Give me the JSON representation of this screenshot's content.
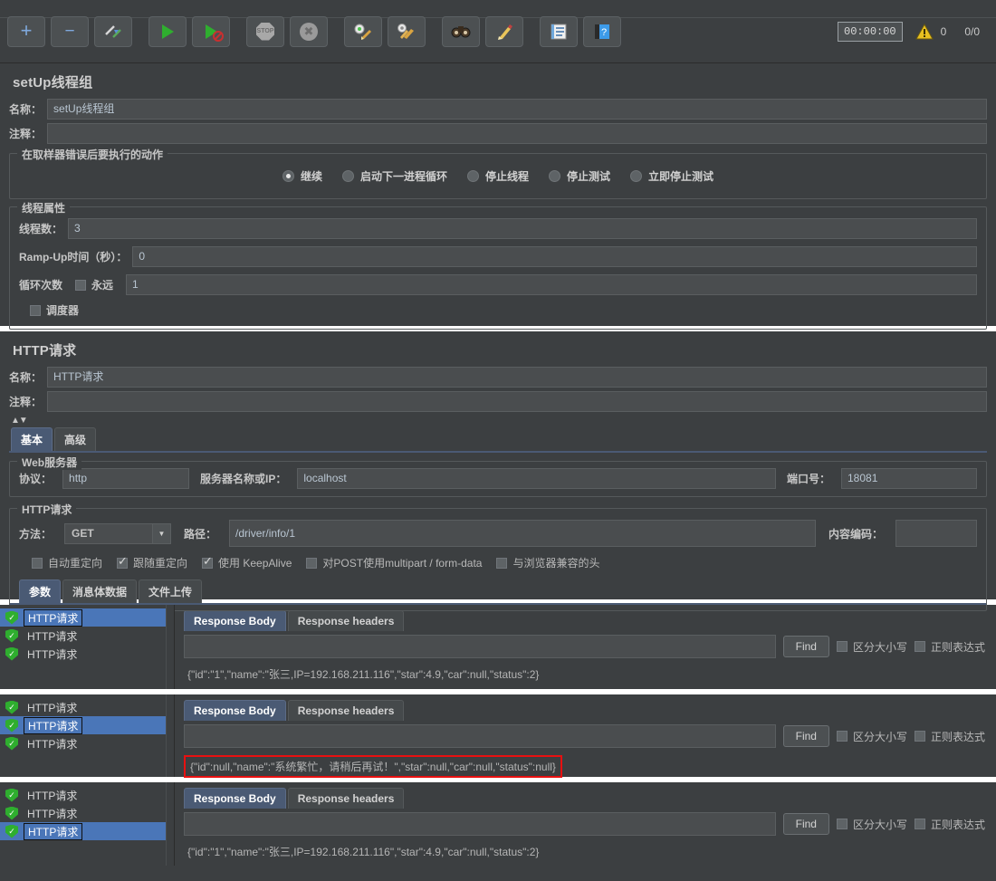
{
  "toolbar": {
    "buttons": [
      {
        "name": "add-button",
        "icon": "plus-icon",
        "title": "+"
      },
      {
        "name": "remove-button",
        "icon": "minus-icon",
        "title": "−"
      },
      {
        "name": "toggle-button",
        "icon": "pencil-toggle-icon",
        "title": ""
      },
      {
        "name": "start-button",
        "icon": "play-icon",
        "title": ""
      },
      {
        "name": "start-no-pauses-button",
        "icon": "play-no-pause-icon",
        "title": ""
      },
      {
        "name": "stop-button",
        "icon": "stop-octagon-icon",
        "title": "STOP"
      },
      {
        "name": "shutdown-button",
        "icon": "shutdown-x-icon",
        "title": ""
      },
      {
        "name": "clear-button",
        "icon": "gear-broom-icon",
        "title": ""
      },
      {
        "name": "clear-all-button",
        "icon": "gears-broom-icon",
        "title": ""
      },
      {
        "name": "search-button",
        "icon": "binoculars-icon",
        "title": ""
      },
      {
        "name": "reset-search-button",
        "icon": "broom-icon",
        "title": ""
      },
      {
        "name": "function-helper-button",
        "icon": "list-icon",
        "title": ""
      },
      {
        "name": "help-button",
        "icon": "help-book-icon",
        "title": "?"
      }
    ],
    "timer": "00:00:00",
    "warning_count": "0",
    "thread_ratio": "0/0"
  },
  "thread_group": {
    "title": "setUp线程组",
    "name_label": "名称：",
    "name_value": "setUp线程组",
    "comment_label": "注释：",
    "comment_value": "",
    "on_error_group": "在取样器错误后要执行的动作",
    "on_error_options": [
      {
        "label": "继续",
        "selected": true
      },
      {
        "label": "启动下一进程循环",
        "selected": false
      },
      {
        "label": "停止线程",
        "selected": false
      },
      {
        "label": "停止测试",
        "selected": false
      },
      {
        "label": "立即停止测试",
        "selected": false
      }
    ],
    "props_group": "线程属性",
    "threads_label": "线程数：",
    "threads_value": "3",
    "rampup_label": "Ramp-Up时间（秒）：",
    "rampup_value": "0",
    "loops_label": "循环次数",
    "forever_label": "永远",
    "forever_checked": false,
    "loops_value": "1",
    "scheduler_label": "调度器",
    "scheduler_checked": false
  },
  "http_request": {
    "title": "HTTP请求",
    "name_label": "名称：",
    "name_value": "HTTP请求",
    "comment_label": "注释：",
    "comment_value": "",
    "tabs": [
      {
        "label": "基本",
        "active": true
      },
      {
        "label": "高级",
        "active": false
      }
    ],
    "webserver_group": "Web服务器",
    "protocol_label": "协议：",
    "protocol_value": "http",
    "server_label": "服务器名称或IP：",
    "server_value": "localhost",
    "port_label": "端口号：",
    "port_value": "18081",
    "request_group": "HTTP请求",
    "method_label": "方法：",
    "method_value": "GET",
    "path_label": "路径：",
    "path_value": "/driver/info/1",
    "encoding_label": "内容编码：",
    "encoding_value": "",
    "checkboxes": [
      {
        "label": "自动重定向",
        "checked": false
      },
      {
        "label": "跟随重定向",
        "checked": true
      },
      {
        "label": "使用 KeepAlive",
        "checked": true
      },
      {
        "label": "对POST使用multipart / form-data",
        "checked": false
      },
      {
        "label": "与浏览器兼容的头",
        "checked": false
      }
    ],
    "param_tabs": [
      {
        "label": "参数",
        "active": true
      },
      {
        "label": "消息体数据",
        "active": false
      },
      {
        "label": "文件上传",
        "active": false
      }
    ]
  },
  "results": {
    "find_label": "Find",
    "find_value": "",
    "case_label": "区分大小写",
    "case_checked": false,
    "regex_label": "正则表达式",
    "regex_checked": false,
    "tabs": [
      {
        "label": "Response Body",
        "active": true
      },
      {
        "label": "Response headers",
        "active": false
      }
    ],
    "panels": [
      {
        "name": "result-panel-1",
        "tree": [
          {
            "label": "HTTP请求",
            "selected": true,
            "status": "success"
          },
          {
            "label": "HTTP请求",
            "selected": false,
            "status": "success"
          },
          {
            "label": "HTTP请求",
            "selected": false,
            "status": "success"
          }
        ],
        "body": "{\"id\":\"1\",\"name\":\"张三,IP=192.168.211.116\",\"star\":4.9,\"car\":null,\"status\":2}",
        "highlighted": false
      },
      {
        "name": "result-panel-2",
        "tree": [
          {
            "label": "HTTP请求",
            "selected": false,
            "status": "success"
          },
          {
            "label": "HTTP请求",
            "selected": true,
            "status": "success"
          },
          {
            "label": "HTTP请求",
            "selected": false,
            "status": "success"
          }
        ],
        "body": "{\"id\":null,\"name\":\"系统繁忙，请稍后再试！\",\"star\":null,\"car\":null,\"status\":null}",
        "highlighted": true
      },
      {
        "name": "result-panel-3",
        "tree": [
          {
            "label": "HTTP请求",
            "selected": false,
            "status": "success"
          },
          {
            "label": "HTTP请求",
            "selected": false,
            "status": "success"
          },
          {
            "label": "HTTP请求",
            "selected": true,
            "status": "success"
          }
        ],
        "body": "{\"id\":\"1\",\"name\":\"张三,IP=192.168.211.116\",\"star\":4.9,\"car\":null,\"status\":2}",
        "highlighted": false
      }
    ]
  },
  "colors": {
    "background": "#3c3f41",
    "field": "#4a4d4f",
    "selection": "#4a76b8",
    "accent_tab": "#4a5a74",
    "success": "#2fae2f",
    "error_border": "#e81010",
    "warning": "#e8c020"
  }
}
